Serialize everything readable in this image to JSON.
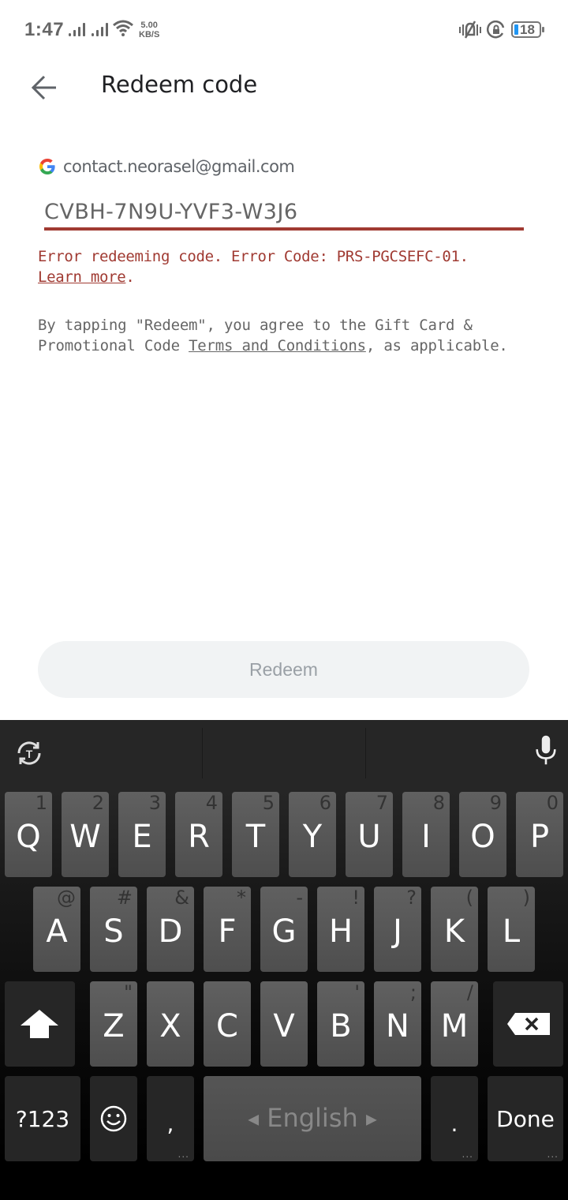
{
  "status_bar": {
    "time": "1:47",
    "net_speed_value": "5.00",
    "net_speed_unit": "KB/S",
    "battery_level": "18",
    "icons": [
      "signal-icon",
      "signal-icon",
      "wifi-icon",
      "vibrate-icon",
      "rotation-lock-icon",
      "battery-icon"
    ],
    "battery_color": "#2196f3"
  },
  "header": {
    "title": "Redeem code",
    "back_icon": "arrow-back-icon"
  },
  "account": {
    "provider_icon": "google-logo-icon",
    "email": "contact.neorasel@gmail.com"
  },
  "code_input": {
    "value": "CVBH-7N9U-YVF3-W3J6",
    "underline_color": "#a03a32"
  },
  "error": {
    "message": "Error redeeming code. Error Code: PRS-PGCSEFC-01.",
    "link_label": "Learn more",
    "suffix": ".",
    "color": "#a03a32"
  },
  "terms": {
    "prefix": "By tapping \"Redeem\", you agree to the Gift Card & Promotional Code ",
    "link_label": "Terms and Conditions",
    "suffix": ", as applicable."
  },
  "redeem_button": {
    "label": "Redeem",
    "enabled": false
  },
  "keyboard": {
    "toolbar": {
      "left_icon": "text-sync-icon",
      "right_icon": "microphone-icon"
    },
    "row1": [
      {
        "key": "Q",
        "alt": "1"
      },
      {
        "key": "W",
        "alt": "2"
      },
      {
        "key": "E",
        "alt": "3"
      },
      {
        "key": "R",
        "alt": "4"
      },
      {
        "key": "T",
        "alt": "5"
      },
      {
        "key": "Y",
        "alt": "6"
      },
      {
        "key": "U",
        "alt": "7"
      },
      {
        "key": "I",
        "alt": "8"
      },
      {
        "key": "O",
        "alt": "9"
      },
      {
        "key": "P",
        "alt": "0"
      }
    ],
    "row2": [
      {
        "key": "A",
        "alt": "@"
      },
      {
        "key": "S",
        "alt": "#"
      },
      {
        "key": "D",
        "alt": "&"
      },
      {
        "key": "F",
        "alt": "*"
      },
      {
        "key": "G",
        "alt": "-"
      },
      {
        "key": "H",
        "alt": "!"
      },
      {
        "key": "J",
        "alt": "?"
      },
      {
        "key": "K",
        "alt": "("
      },
      {
        "key": "L",
        "alt": ")"
      }
    ],
    "row3": [
      {
        "key": "Z",
        "alt": "\""
      },
      {
        "key": "X",
        "alt": ""
      },
      {
        "key": "C",
        "alt": ""
      },
      {
        "key": "V",
        "alt": ""
      },
      {
        "key": "B",
        "alt": "'"
      },
      {
        "key": "N",
        "alt": ";"
      },
      {
        "key": "M",
        "alt": "/"
      }
    ],
    "symbols_label": "?123",
    "comma_label": ",",
    "space_label": "English",
    "period_label": ".",
    "done_label": "Done",
    "more_dots": "..."
  }
}
